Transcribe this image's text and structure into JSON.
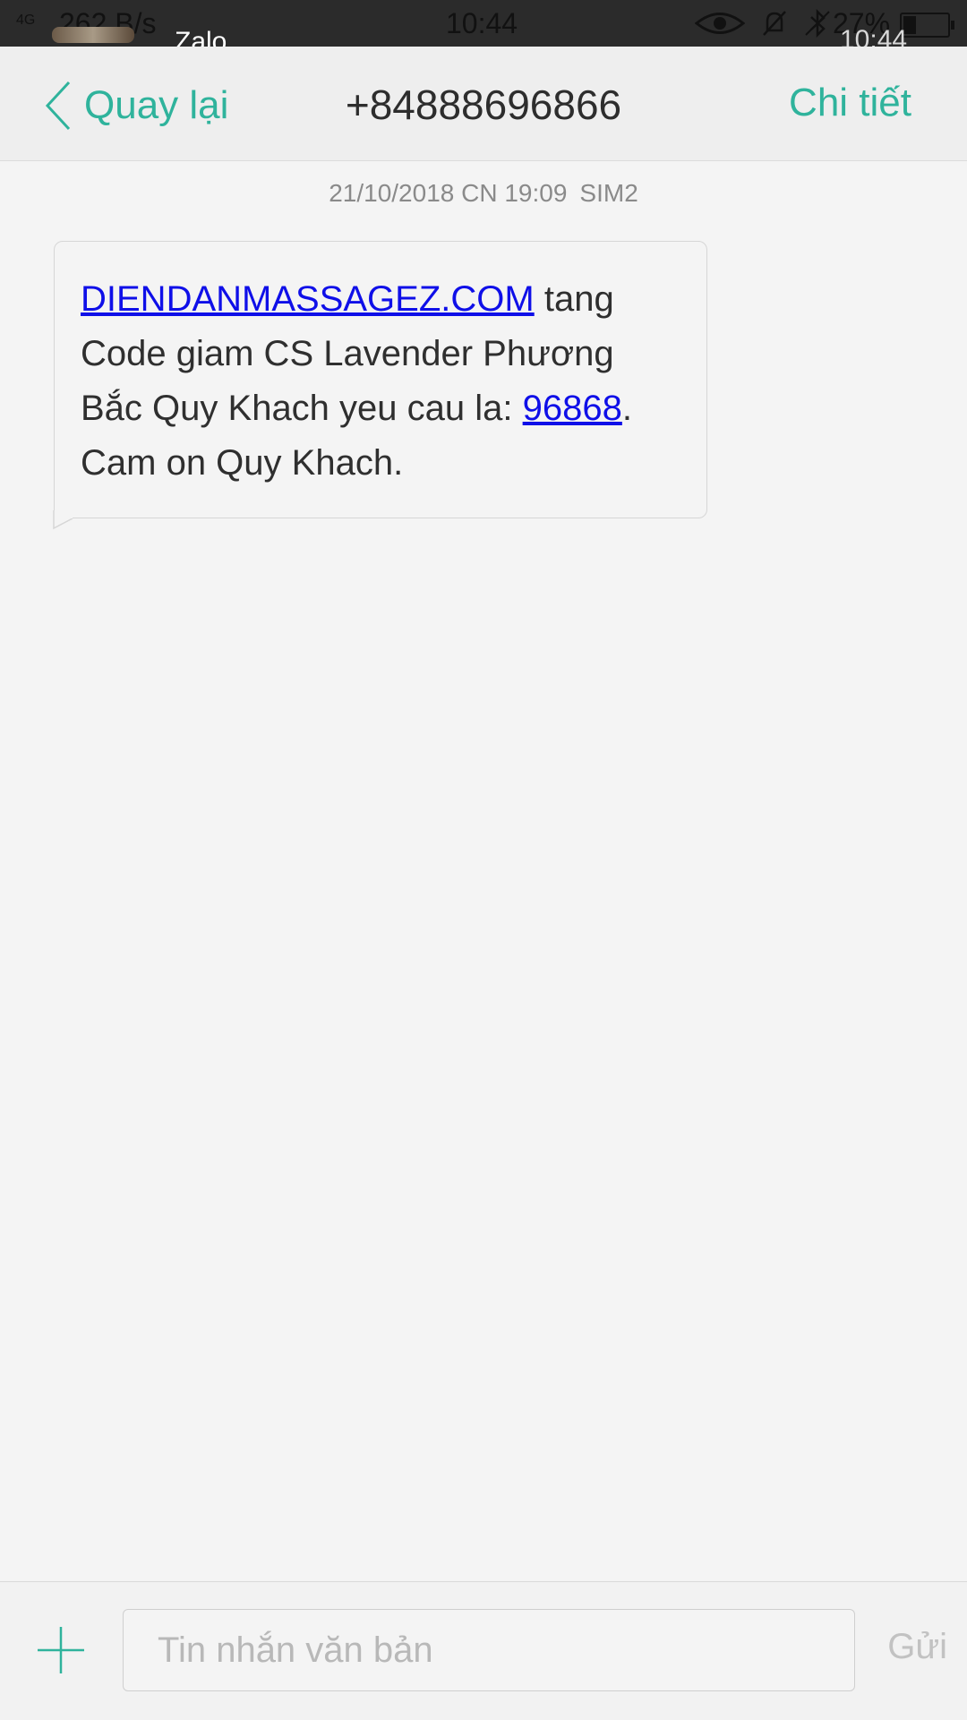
{
  "status_bar": {
    "network": "4G",
    "speed": "262 B/s",
    "time": "10:44",
    "battery": "27%",
    "notification_app": "Zalo",
    "notification_time": "10:44",
    "icons": [
      "eye-icon",
      "bell-muted-icon",
      "bluetooth-icon",
      "battery-icon"
    ]
  },
  "header": {
    "back_label": "Quay lại",
    "contact": "+84888696866",
    "details_label": "Chi tiết"
  },
  "conversation": {
    "timestamp": "21/10/2018 CN 19:09",
    "sim": "SIM2",
    "message": {
      "link_text": "DIENDANMASSAGEZ.COM",
      "text_1": " tang Code giam CS Lavender Phương Bắc Quy Khach yeu cau la: ",
      "code": "96868",
      "text_2": ". Cam on Quy Khach."
    }
  },
  "input_bar": {
    "placeholder": "Tin nhắn văn bản",
    "value": "",
    "send_label": "Gửi"
  },
  "colors": {
    "accent": "#2fb39c",
    "link": "#0f0fe8",
    "background": "#f4f4f4"
  }
}
